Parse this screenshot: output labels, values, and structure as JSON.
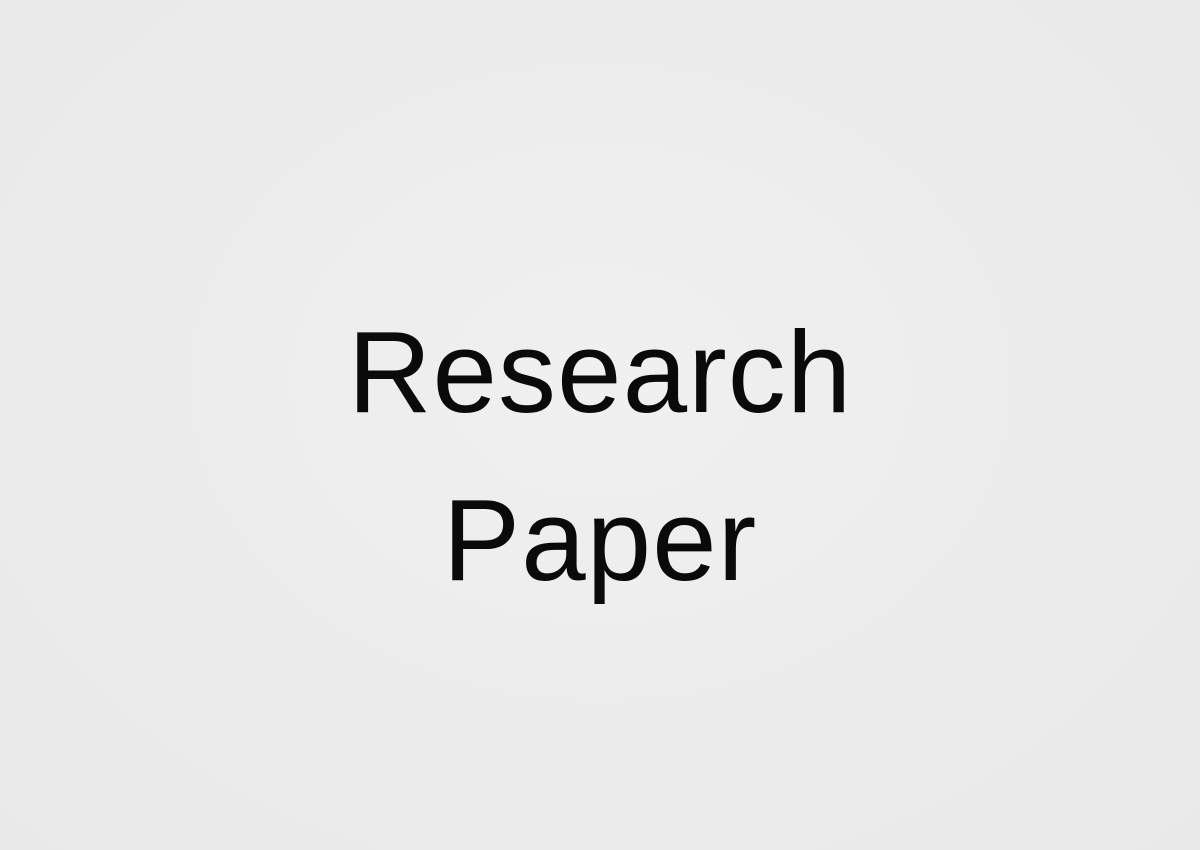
{
  "title": {
    "line1": "Research",
    "line2": "Paper"
  },
  "colors": {
    "background": "#ededed",
    "text": "#0a0a0a"
  }
}
